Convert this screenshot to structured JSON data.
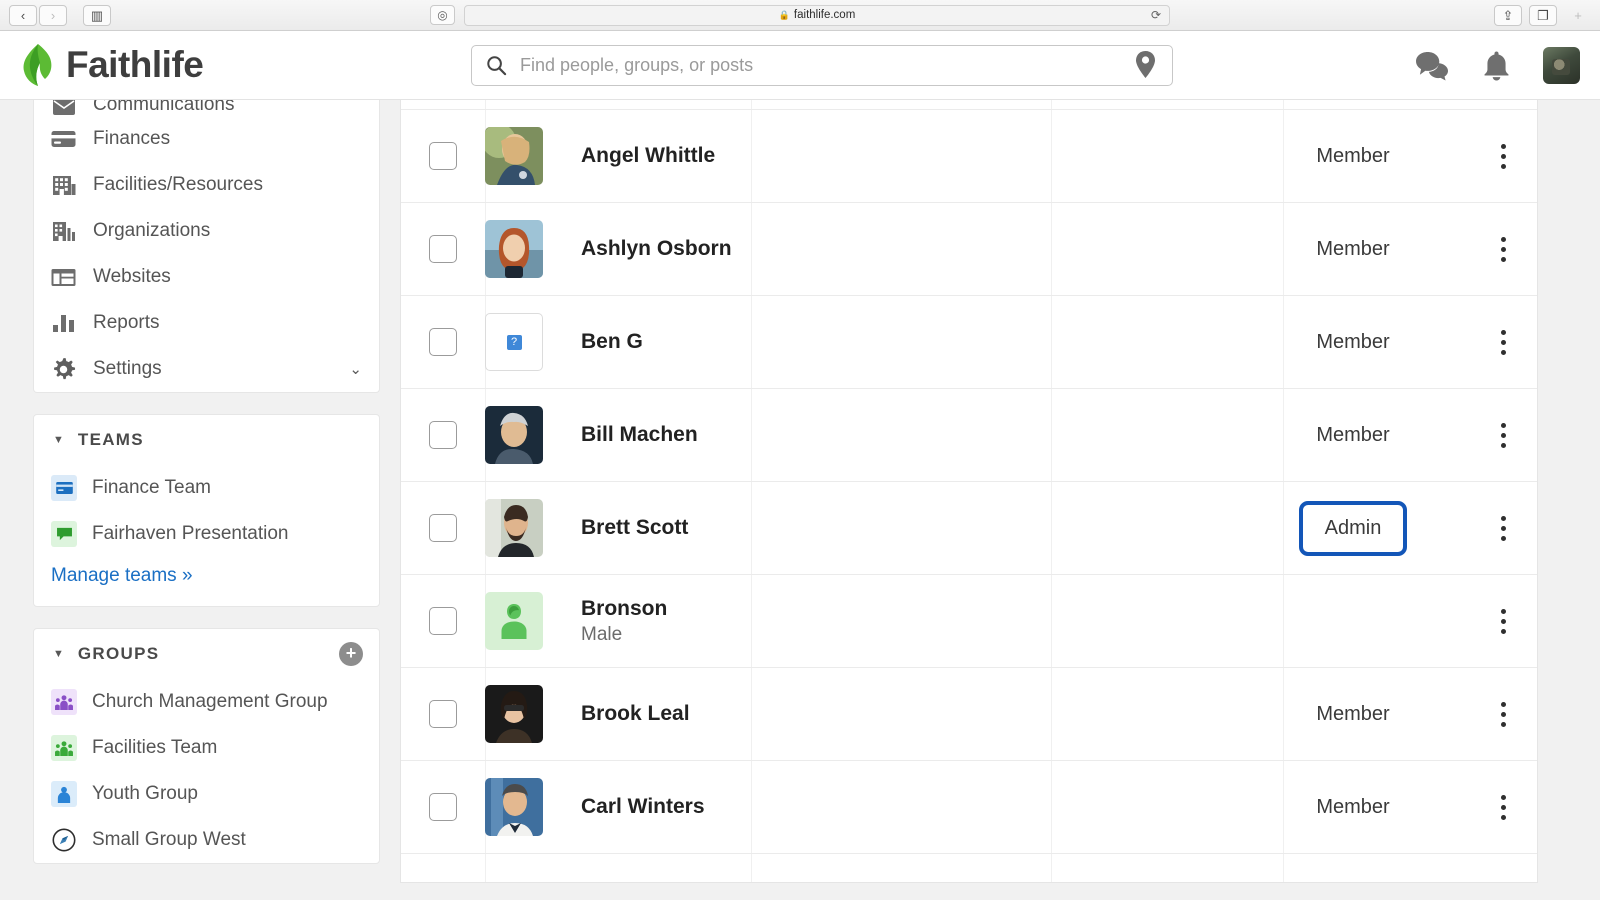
{
  "browser": {
    "back_icon": "‹",
    "forward_icon": "›",
    "sidebar_icon": "▥",
    "reader_icon": "◎",
    "url": "faithlife.com",
    "lock_icon": "🔒",
    "reload_icon": "⟳",
    "share_icon": "⇪",
    "tabs_icon": "❐",
    "new_tab_icon": "+"
  },
  "header": {
    "brand": "Faithlife",
    "logo_icon": "flame-leaf-icon",
    "search": {
      "placeholder": "Find people, groups, or posts",
      "value": "",
      "search_icon": "⌕",
      "location_icon": "location-pin"
    },
    "messages_icon": "chat-bubbles",
    "notifications_icon": "bell",
    "avatar_alt": "user-avatar"
  },
  "sidebar": {
    "nav": [
      {
        "label": "Communications",
        "icon": "envelope-icon",
        "clipped": true
      },
      {
        "label": "Finances",
        "icon": "credit-card-icon",
        "clipped": false
      },
      {
        "label": "Facilities/Resources",
        "icon": "building-grid-icon",
        "clipped": false
      },
      {
        "label": "Organizations",
        "icon": "org-building-icon",
        "clipped": false
      },
      {
        "label": "Websites",
        "icon": "layout-icon",
        "clipped": false
      },
      {
        "label": "Reports",
        "icon": "bar-chart-icon",
        "clipped": false
      },
      {
        "label": "Settings",
        "icon": "gear-icon",
        "clipped": false,
        "chevron": "⌄"
      }
    ],
    "teams": {
      "title": "TEAMS",
      "caret": "▼",
      "items": [
        {
          "label": "Finance Team",
          "icon": "credit-card-icon",
          "color": "#1c6fc0",
          "bg": "#dbeaf8"
        },
        {
          "label": "Fairhaven Presentation",
          "icon": "chat-icon",
          "color": "#2e9c2e",
          "bg": "#ddf4dd"
        }
      ],
      "manage_link": "Manage teams »"
    },
    "groups": {
      "title": "GROUPS",
      "caret": "▼",
      "add_icon": "+",
      "items": [
        {
          "label": "Church Management Group",
          "icon": "people-icon",
          "color": "#8a4fc6",
          "bg": "#efe2fa"
        },
        {
          "label": "Facilities Team",
          "icon": "people-icon",
          "color": "#3aaa3a",
          "bg": "#ddf4dd"
        },
        {
          "label": "Youth Group",
          "icon": "person-icon",
          "color": "#2b84d6",
          "bg": "#dbecfa"
        },
        {
          "label": "Small Group West",
          "icon": "compass-icon",
          "color": "#2d2d2d",
          "bg": "#ffffff"
        }
      ]
    }
  },
  "members": {
    "kebab_icon": "vertical-dots",
    "rows": [
      {
        "name": "Angel Whittle",
        "sub": "",
        "role": "Member",
        "avatar": "photo",
        "photo": "angel",
        "highlighted": false
      },
      {
        "name": "Ashlyn Osborn",
        "sub": "",
        "role": "Member",
        "avatar": "photo",
        "photo": "ashlyn",
        "highlighted": false
      },
      {
        "name": "Ben G",
        "sub": "",
        "role": "Member",
        "avatar": "broken",
        "photo": "",
        "highlighted": false
      },
      {
        "name": "Bill Machen",
        "sub": "",
        "role": "Member",
        "avatar": "photo",
        "photo": "bill",
        "highlighted": false
      },
      {
        "name": "Brett Scott",
        "sub": "",
        "role": "Admin",
        "avatar": "photo",
        "photo": "brett",
        "highlighted": true
      },
      {
        "name": "Bronson",
        "sub": "Male",
        "role": "",
        "avatar": "placeholder",
        "photo": "",
        "highlighted": false
      },
      {
        "name": "Brook Leal",
        "sub": "",
        "role": "Member",
        "avatar": "photo",
        "photo": "brook",
        "highlighted": false
      },
      {
        "name": "Carl Winters",
        "sub": "",
        "role": "Member",
        "avatar": "photo",
        "photo": "carl",
        "highlighted": false
      }
    ]
  },
  "colors": {
    "brand_green": "#4caf30",
    "highlight_blue": "#1356b8",
    "link_blue": "#1a6fc4"
  }
}
